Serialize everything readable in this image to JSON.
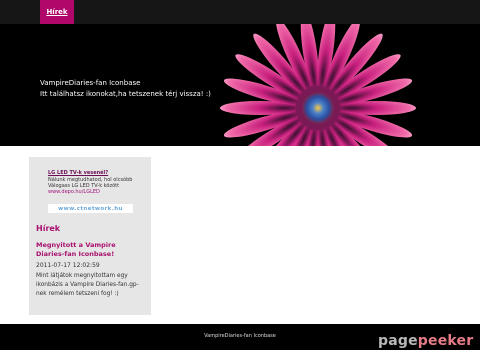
{
  "nav": {
    "tab_label": "Hírek"
  },
  "header": {
    "title": "VampireDiaries-fan Iconbase",
    "subtitle": "Itt találhatsz ikonokat,ha tetszenek térj vissza! :)"
  },
  "sidebar": {
    "ad": {
      "title": "LG LED TV-k vesenél?",
      "line1": "Nálunk megtudhatod, hol olcsóbb",
      "line2": "Válogass LG LED TV-k között",
      "url": "www.depo.hu/LGLED"
    },
    "network_badge": "www.ctnetwork.hu",
    "news": {
      "heading": "Hírek",
      "post_title": "Megnyitott a Vampire Diaries-fan Iconbase!",
      "post_date": "2011-07-17 12:02:59",
      "post_body": "Mint látjátok megnyitottam egy ikonbázis a Vampire Diaries-fan.gp-nek remélem tetszeni fog! :)"
    }
  },
  "footer": {
    "text": "VampireDiaries-fan Iconbase"
  },
  "watermark": {
    "part1": "page",
    "part2": "peeker"
  },
  "colors": {
    "accent": "#b0076a",
    "heading": "#a8106e",
    "sidebar_bg": "#e6e6e6"
  }
}
